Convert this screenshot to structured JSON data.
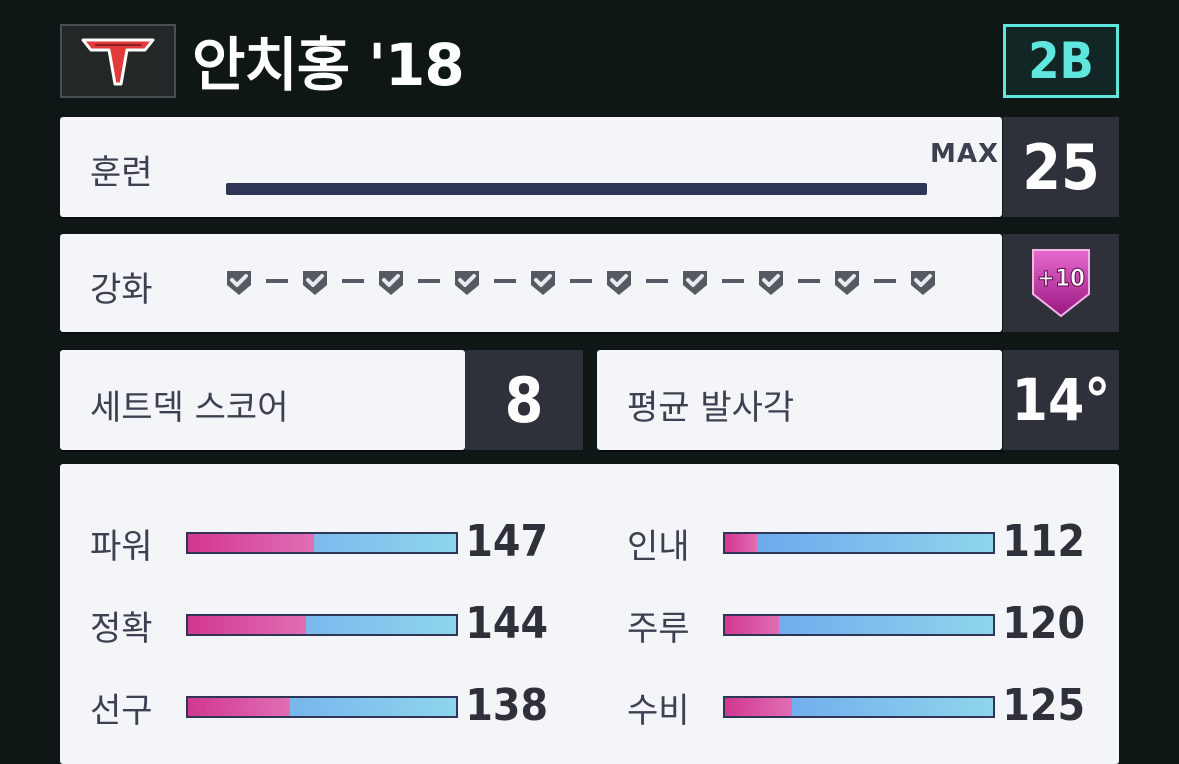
{
  "header": {
    "team_logo_icon": "team-t-logo-icon",
    "player_name": "안치홍 '18",
    "position": "2B"
  },
  "training": {
    "label": "훈련",
    "max_label": "MAX",
    "level": "25",
    "progress": 1.0
  },
  "enhance": {
    "label": "강화",
    "check_count": 10,
    "badge": "+10"
  },
  "setdeck": {
    "label": "세트덱 스코어",
    "value": "8"
  },
  "launch_angle": {
    "label": "평균 발사각",
    "value": "14°"
  },
  "stats": [
    {
      "label": "파워",
      "value": "147",
      "ratio": 0.47
    },
    {
      "label": "정확",
      "value": "144",
      "ratio": 0.44
    },
    {
      "label": "선구",
      "value": "138",
      "ratio": 0.38
    },
    {
      "label": "인내",
      "value": "112",
      "ratio": 0.12
    },
    {
      "label": "주루",
      "value": "120",
      "ratio": 0.2
    },
    {
      "label": "수비",
      "value": "125",
      "ratio": 0.25
    }
  ],
  "colors": {
    "accent_position": "#5ee6df",
    "bar_dark": "#2e3556",
    "stat_pink": "#d2378f",
    "stat_blue": "#6aa2ee",
    "badge_magenta": "#b0208e"
  }
}
